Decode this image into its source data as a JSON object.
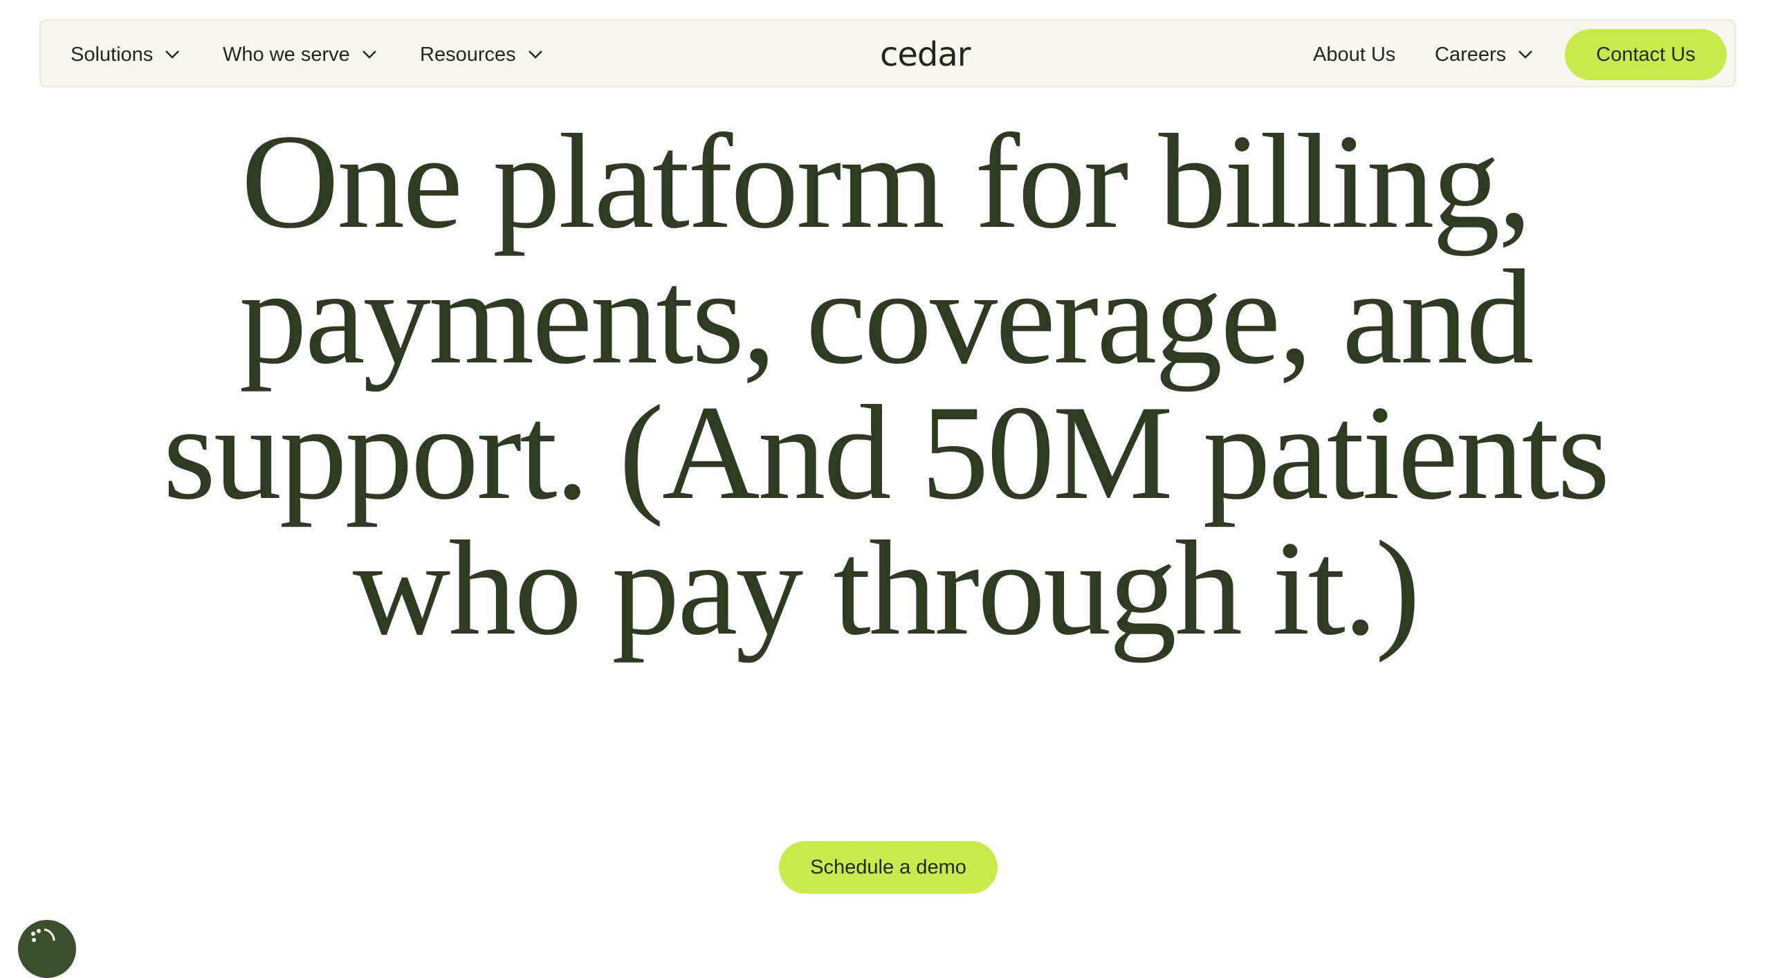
{
  "nav": {
    "left_items": [
      {
        "label": "Solutions",
        "has_dropdown": true,
        "icon": "chevron-down-icon"
      },
      {
        "label": "Who we serve",
        "has_dropdown": true,
        "icon": "chevron-down-icon"
      },
      {
        "label": "Resources",
        "has_dropdown": true,
        "icon": "chevron-down-icon"
      }
    ],
    "logo": "cedar",
    "right_items": [
      {
        "label": "About Us",
        "has_dropdown": false
      },
      {
        "label": "Careers",
        "has_dropdown": true,
        "icon": "chevron-down-icon"
      }
    ],
    "contact_label": "Contact Us"
  },
  "hero": {
    "headline_lines": [
      "One platform for billing,",
      "payments, coverage, and",
      "support. (And 50M patients",
      "who pay through it.)"
    ],
    "cta_label": "Schedule a demo"
  },
  "widgets": {
    "accessibility_icon": "accessibility-icon"
  },
  "colors": {
    "accent": "#c8eb4b",
    "headline_text": "#2f3b20",
    "nav_background": "#f8f6f1",
    "nav_border": "#ebe8d6",
    "widget_background": "#3c4f2c"
  }
}
